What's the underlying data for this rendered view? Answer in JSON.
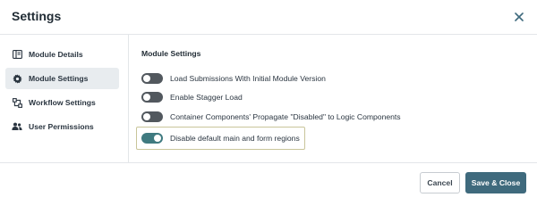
{
  "dialog": {
    "title": "Settings"
  },
  "sidebar": {
    "items": [
      {
        "label": "Module Details",
        "icon": "module-details-icon"
      },
      {
        "label": "Module Settings",
        "icon": "gear-icon",
        "active": true
      },
      {
        "label": "Workflow Settings",
        "icon": "workflow-icon"
      },
      {
        "label": "User Permissions",
        "icon": "users-icon"
      }
    ]
  },
  "main": {
    "section_title": "Module Settings",
    "settings": [
      {
        "label": "Load Submissions With Initial Module Version",
        "on": false
      },
      {
        "label": "Enable Stagger Load",
        "on": false
      },
      {
        "label": "Container Components' Propagate \"Disabled\" to Logic Components",
        "on": false
      },
      {
        "label": "Disable default main and form regions",
        "on": true
      }
    ]
  },
  "footer": {
    "cancel_label": "Cancel",
    "save_label": "Save & Close"
  },
  "colors": {
    "toggle_off": "#52585e",
    "toggle_on": "#3f7a80",
    "primary": "#3f6a7d",
    "active_nav": "#e8ecef",
    "highlight_outline": "#c9c59a"
  }
}
